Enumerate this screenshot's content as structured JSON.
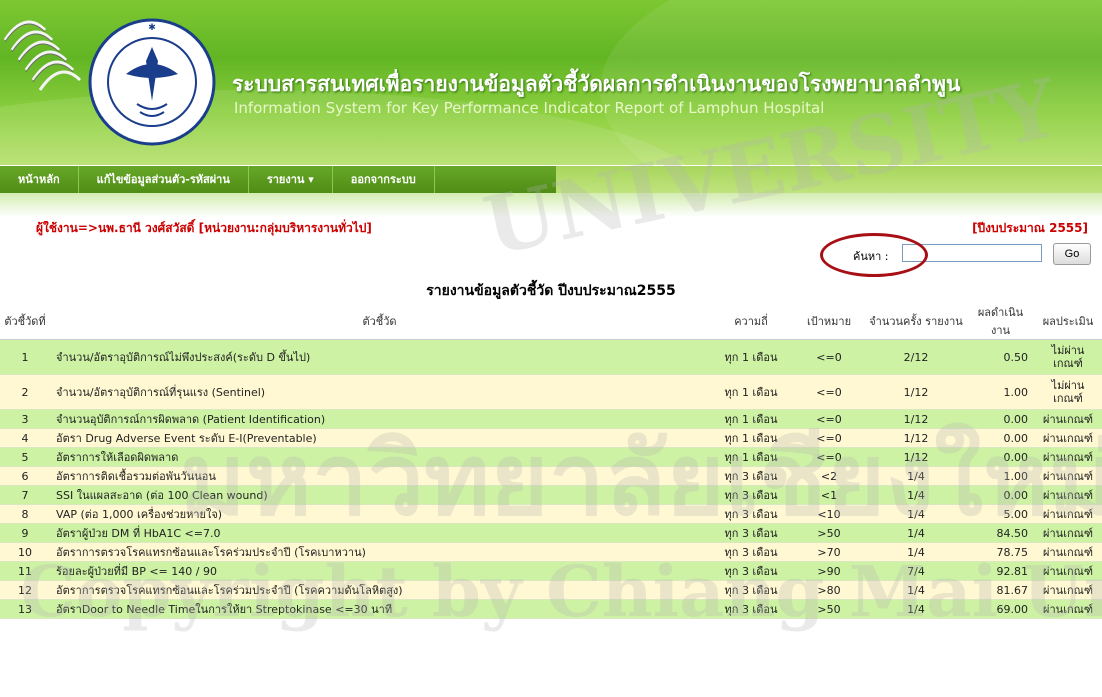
{
  "header": {
    "title_th": "ระบบสารสนเทศเพื่อรายงานข้อมูลตัวชี้วัดผลการดำเนินงานของโรงพยาบาลลำพูน",
    "title_en": "Information System for Key Performance Indicator Report of Lamphun Hospital",
    "logo_text": "โรงพยาบาลลำพูน สำนักงานปลัดกระทรวงสาธารณสุข"
  },
  "nav": {
    "items": [
      "หน้าหลัก",
      "แก้ไขข้อมูลส่วนตัว-รหัสผ่าน",
      "รายงาน ▾",
      "ออกจากระบบ"
    ]
  },
  "user": {
    "line": "ผู้ใช้งาน=>นพ.ธานี วงศ์สวัสดิ์ [หน่วยงาน:กลุ่มบริหารงานทั่วไป]",
    "fiscal_year": "[ปีงบประมาณ 2555]"
  },
  "search": {
    "label": "ค้นหา :",
    "value": "",
    "button": "Go"
  },
  "report": {
    "title": "รายงานข้อมูลตัวชี้วัด ปีงบประมาณ2555",
    "headers": [
      "ตัวชี้วัดที่",
      "ตัวชี้วัด",
      "ความถี่",
      "เป้าหมาย",
      "จำนวนครั้ง รายงาน",
      "ผลดำเนิน งาน",
      "ผลประเมิน"
    ],
    "rows": [
      [
        "1",
        "จำนวน/อัตราอุบัติการณ์ไม่พึงประสงค์(ระดับ D ขึ้นไป)",
        "ทุก 1 เดือน",
        "<=0",
        "2/12",
        "0.50",
        "ไม่ผ่าน เกณฑ์"
      ],
      [
        "2",
        "จำนวน/อัตราอุบัติการณ์ที่รุนแรง (Sentinel)",
        "ทุก 1 เดือน",
        "<=0",
        "1/12",
        "1.00",
        "ไม่ผ่าน เกณฑ์"
      ],
      [
        "3",
        "จำนวนอุบัติการณ์การผิดพลาด (Patient Identification)",
        "ทุก 1 เดือน",
        "<=0",
        "1/12",
        "0.00",
        "ผ่านเกณฑ์"
      ],
      [
        "4",
        "อัตรา Drug Adverse Event ระดับ E-I(Preventable)",
        "ทุก 1 เดือน",
        "<=0",
        "1/12",
        "0.00",
        "ผ่านเกณฑ์"
      ],
      [
        "5",
        "อัตราการให้เลือดผิดพลาด",
        "ทุก 1 เดือน",
        "<=0",
        "1/12",
        "0.00",
        "ผ่านเกณฑ์"
      ],
      [
        "6",
        "อัตราการติดเชื้อรวมต่อพันวันนอน",
        "ทุก 3 เดือน",
        "<2",
        "1/4",
        "1.00",
        "ผ่านเกณฑ์"
      ],
      [
        "7",
        "SSI ในแผลสะอาด (ต่อ 100 Clean wound)",
        "ทุก 3 เดือน",
        "<1",
        "1/4",
        "0.00",
        "ผ่านเกณฑ์"
      ],
      [
        "8",
        "VAP (ต่อ 1,000 เครื่องช่วยหายใจ)",
        "ทุก 3 เดือน",
        "<10",
        "1/4",
        "5.00",
        "ผ่านเกณฑ์"
      ],
      [
        "9",
        "อัตราผู้ป่วย DM ที่ HbA1C <=7.0",
        "ทุก 3 เดือน",
        ">50",
        "1/4",
        "84.50",
        "ผ่านเกณฑ์"
      ],
      [
        "10",
        "อัตราการตรวจโรคแทรกซ้อนและโรคร่วมประจำปี (โรคเบาหวาน)",
        "ทุก 3 เดือน",
        ">70",
        "1/4",
        "78.75",
        "ผ่านเกณฑ์"
      ],
      [
        "11",
        "ร้อยละผู้ป่วยที่มี BP <= 140 / 90",
        "ทุก 3 เดือน",
        ">90",
        "7/4",
        "92.81",
        "ผ่านเกณฑ์"
      ],
      [
        "12",
        "อัตราการตรวจโรคแทรกซ้อนและโรคร่วมประจำปี (โรคความดันโลหิตสูง)",
        "ทุก 3 เดือน",
        ">80",
        "1/4",
        "81.67",
        "ผ่านเกณฑ์"
      ],
      [
        "13",
        "อัตราDoor to Needle Timeในการให้ยา Streptokinase <=30 นาที",
        "ทุก 3 เดือน",
        ">50",
        "1/4",
        "69.00",
        "ผ่านเกณฑ์"
      ]
    ]
  },
  "colors": {
    "banner": "#62b524",
    "nav": "#4f8d16",
    "row_green": "#cdf2a4",
    "row_yellow": "#fff8d2",
    "user_text": "#cc0000",
    "annotation_circle": "#a80f14"
  },
  "watermark": {
    "line1": "มหาวิทยาลัยเชียงใหม่",
    "line2": "Copyright by Chiang Mai University",
    "line3": "UNIVERSITY"
  }
}
